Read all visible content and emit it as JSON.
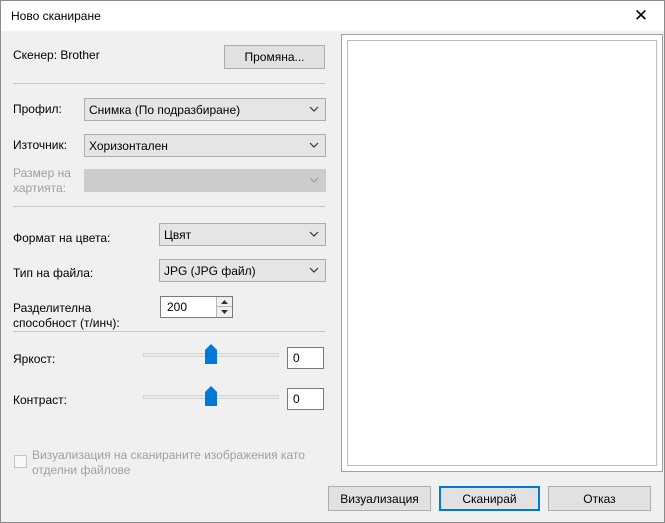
{
  "window": {
    "title": "Ново сканиране"
  },
  "scanner": {
    "label": "Скенер: Brother",
    "change_button": "Промяна..."
  },
  "profile": {
    "label": "Профил:",
    "value": "Снимка (По подразбиране)"
  },
  "source": {
    "label": "Източник:",
    "value": "Хоризонтален"
  },
  "paper_size": {
    "label_line1": "Размер на",
    "label_line2": "хартията:",
    "value": ""
  },
  "color_format": {
    "label": "Формат на цвета:",
    "value": "Цвят"
  },
  "file_type": {
    "label": "Тип на файла:",
    "value": "JPG (JPG файл)"
  },
  "resolution": {
    "label_line1": "Разделителна",
    "label_line2": "способност (т/инч):",
    "value": "200"
  },
  "brightness": {
    "label": "Яркост:",
    "value": "0",
    "slider_level": 0.5
  },
  "contrast": {
    "label": "Контраст:",
    "value": "0",
    "slider_level": 0.5
  },
  "separate_files": {
    "label_line1": "Визуализация на сканираните изображения като",
    "label_line2": "отделни файлове",
    "checked": false
  },
  "buttons": {
    "preview": "Визуализация",
    "scan": "Сканирай",
    "cancel": "Отказ"
  },
  "colors": {
    "accent": "#0078d7",
    "background": "#f0f0f0"
  }
}
